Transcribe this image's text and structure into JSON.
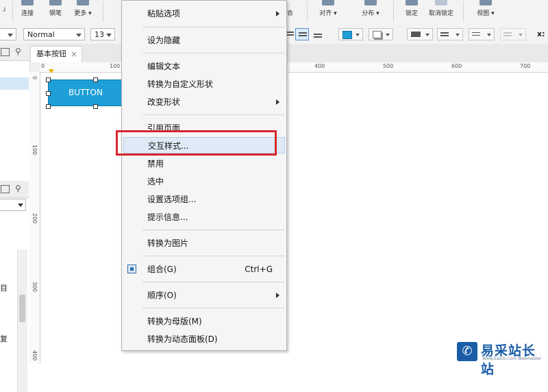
{
  "toolbar": {
    "connect_label": "连接",
    "pen_label": "钢笔",
    "more_label": "更多 ▾",
    "combine_label": "组合",
    "align_label": "对齐 ▾",
    "distribute_label": "分布 ▾",
    "lock_label": "锁定",
    "unlock_label": "取消锁定",
    "view_label": "视图 ▾"
  },
  "formatbar": {
    "style_value": "Normal",
    "size_value": "13",
    "coord_label": "x:"
  },
  "tab": {
    "title": "基本按钮",
    "close": "×"
  },
  "ruler": {
    "h_labels": [
      "0",
      "100",
      "400",
      "500",
      "600",
      "700"
    ],
    "v_labels": [
      "0",
      "100",
      "200",
      "300",
      "400"
    ]
  },
  "widget": {
    "label": "BUTTON",
    "color": "#1e9fd8"
  },
  "left_panel": {
    "text_a": "目",
    "text_b": "复"
  },
  "context_menu": {
    "items": [
      {
        "label": "粘贴选项",
        "submenu": true
      },
      {
        "label": "设为隐藏"
      },
      {
        "label": "编辑文本"
      },
      {
        "label": "转换为自定义形状"
      },
      {
        "label": "改变形状",
        "submenu": true
      },
      {
        "label": "引用页面"
      },
      {
        "label": "交互样式..."
      },
      {
        "label": "禁用"
      },
      {
        "label": "选中"
      },
      {
        "label": "设置选项组..."
      },
      {
        "label": "提示信息..."
      },
      {
        "label": "转换为图片"
      },
      {
        "label": "组合(G)",
        "shortcut": "Ctrl+G",
        "icon": "group-icon"
      },
      {
        "label": "顺序(O)",
        "submenu": true
      },
      {
        "label": "转换为母版(M)"
      },
      {
        "label": "转换为动态面板(D)"
      }
    ],
    "highlight_color": "#d8252b"
  },
  "watermark": {
    "brand": "易采站长站",
    "url": "Www.Easck.Com Webmaster"
  }
}
